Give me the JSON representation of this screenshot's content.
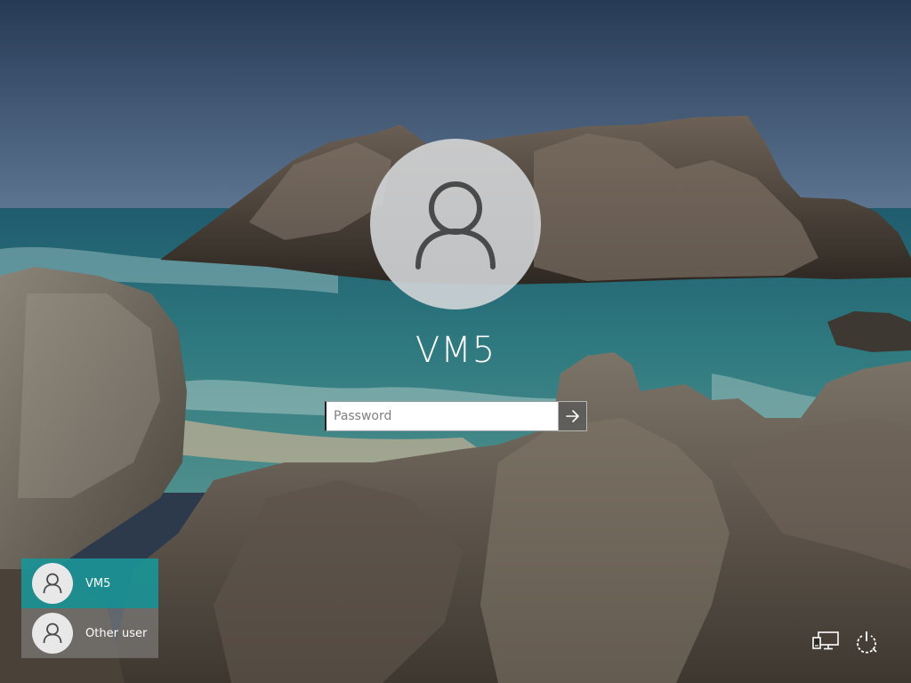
{
  "login": {
    "user_name": "VM5",
    "password_placeholder": "Password",
    "submit_icon": "arrow-right-icon"
  },
  "user_list": [
    {
      "label": "VM5",
      "selected": true,
      "icon": "user-icon"
    },
    {
      "label": "Other user",
      "selected": false,
      "icon": "user-icon"
    }
  ],
  "system_icons": [
    {
      "name": "network-icon"
    },
    {
      "name": "power-icon"
    }
  ],
  "colors": {
    "selected_tile": "#1b9496",
    "avatar_bg": "#d6d8db",
    "icon_stroke": "#4a4a4a"
  }
}
